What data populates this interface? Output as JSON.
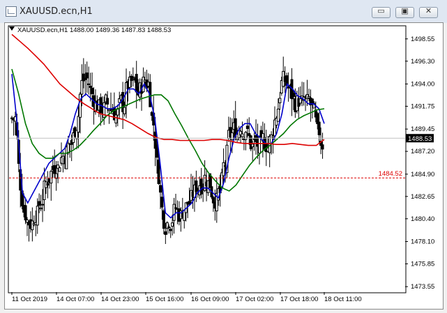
{
  "window": {
    "title": "XAUUSD.ecn,H1",
    "controls": {
      "minimize": "▭",
      "restore": "▣",
      "close": "✕"
    }
  },
  "chart_header": "XAUUSD.ecn,H1  1488.00 1489.36 1487.83 1488.53",
  "chart_data": {
    "type": "candlestick",
    "symbol": "XAUUSD.ecn",
    "timeframe": "H1",
    "ohlc_last": {
      "open": 1488.0,
      "high": 1489.36,
      "low": 1487.83,
      "close": 1488.53
    },
    "current_price_label": "1488.53",
    "horizontal_level_label": "1484.52",
    "horizontal_level_value": 1484.52,
    "y_ticks": [
      "1498.55",
      "1496.30",
      "1494.00",
      "1491.75",
      "1489.45",
      "1487.20",
      "1484.90",
      "1482.65",
      "1480.40",
      "1478.10",
      "1475.85",
      "1473.55"
    ],
    "x_ticks": [
      "11 Oct 2019",
      "14 Oct 07:00",
      "14 Oct 23:00",
      "15 Oct 16:00",
      "16 Oct 09:00",
      "17 Oct 02:00",
      "17 Oct 18:00",
      "18 Oct 11:00"
    ],
    "ylim": [
      1473.0,
      1499.8
    ],
    "close_series": [
      1490.5,
      1484,
      1481,
      1480,
      1481,
      1482,
      1484,
      1485,
      1486,
      1486.5,
      1487,
      1488,
      1490,
      1494,
      1494.5,
      1493,
      1492,
      1491.5,
      1492,
      1491.5,
      1491,
      1492,
      1494,
      1494,
      1493,
      1494,
      1494,
      1490,
      1485,
      1480.5,
      1480.5,
      1481,
      1481,
      1481.5,
      1482,
      1483,
      1484,
      1484.5,
      1484,
      1482.5,
      1483,
      1486,
      1489,
      1489.5,
      1490,
      1489.5,
      1488,
      1488,
      1487.5,
      1488,
      1488.5,
      1491,
      1494,
      1494,
      1493,
      1492,
      1492,
      1492,
      1491.5,
      1489,
      1488
    ],
    "series": [
      {
        "color": "#0000cc",
        "values": [
          1495,
          1490,
          1483,
          1482,
          1483,
          1484,
          1485,
          1486,
          1486.5,
          1487,
          1487.5,
          1489,
          1491,
          1492.5,
          1493,
          1492.5,
          1492,
          1491.8,
          1491.5,
          1491.5,
          1491.8,
          1492.5,
          1493.5,
          1493.5,
          1493,
          1494,
          1493,
          1490.5,
          1486,
          1481,
          1480.5,
          1481,
          1481,
          1481.5,
          1482,
          1483,
          1483.5,
          1483.5,
          1483,
          1482.5,
          1484,
          1486.5,
          1488.5,
          1489.5,
          1490,
          1490,
          1489,
          1488.5,
          1488,
          1488,
          1489,
          1491,
          1494,
          1493.5,
          1492.8,
          1492.5,
          1492,
          1492,
          1491.5,
          1490
        ]
      },
      {
        "color": "#007700",
        "values": [
          1495.5,
          1493,
          1490,
          1488,
          1487,
          1486.5,
          1486.5,
          1487,
          1487,
          1487.3,
          1487.8,
          1488.5,
          1489.3,
          1490,
          1490.8,
          1491.3,
          1491.6,
          1491.9,
          1492.2,
          1492.5,
          1492.7,
          1492.9,
          1492.9,
          1492.3,
          1491,
          1489.8,
          1488.5,
          1487.3,
          1486,
          1485,
          1484.2,
          1483.5,
          1483.2,
          1483.8,
          1484.8,
          1485.8,
          1486.6,
          1487.3,
          1487.8,
          1488.4,
          1489,
          1489.8,
          1490.4,
          1490.8,
          1491.1,
          1491.4,
          1491.5
        ]
      },
      {
        "color": "#dd0000",
        "values": [
          1499,
          1498.3,
          1497.6,
          1496.8,
          1496,
          1495,
          1494,
          1493.3,
          1492.6,
          1492,
          1491.5,
          1491,
          1490.8,
          1490.6,
          1490.4,
          1490,
          1489.5,
          1489,
          1488.6,
          1488.4,
          1488.4,
          1488.3,
          1488.3,
          1488.3,
          1488.3,
          1488.4,
          1488.4,
          1488.3,
          1488.1,
          1488,
          1488,
          1488,
          1488,
          1487.9,
          1487.9,
          1488,
          1487.9,
          1487.8,
          1487.8,
          1488.4
        ]
      }
    ]
  }
}
